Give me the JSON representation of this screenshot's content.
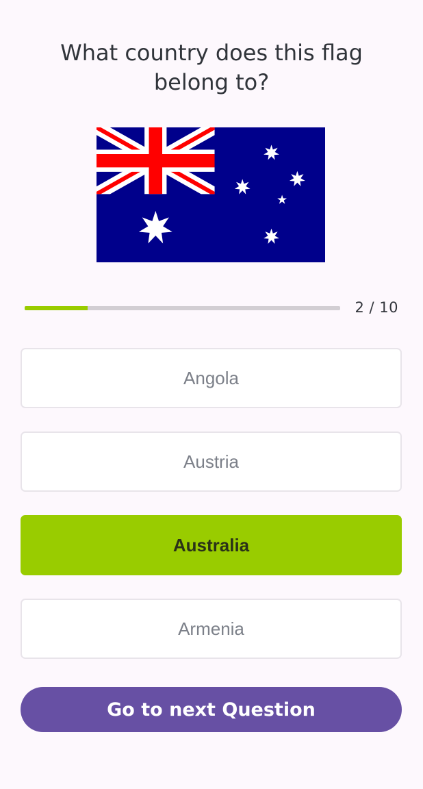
{
  "question": {
    "text": "What country does this flag belong to?"
  },
  "flag": {
    "icon": "australia-flag",
    "colors": {
      "blue": "#00008b",
      "red": "#ff0000",
      "white": "#ffffff"
    }
  },
  "progress": {
    "current": 2,
    "total": 10,
    "label": "2 / 10",
    "fraction": 0.2,
    "fill_color": "#99cc00",
    "track_color": "#d2ced3"
  },
  "options": [
    {
      "label": "Angola",
      "selected": false
    },
    {
      "label": "Austria",
      "selected": false
    },
    {
      "label": "Australia",
      "selected": true
    },
    {
      "label": "Armenia",
      "selected": false
    }
  ],
  "next_button": {
    "label": "Go to next Question",
    "color": "#6750a4"
  },
  "colors": {
    "background": "#fdf8fd",
    "selected_option": "#99cc00",
    "option_text": "#7c8089"
  }
}
